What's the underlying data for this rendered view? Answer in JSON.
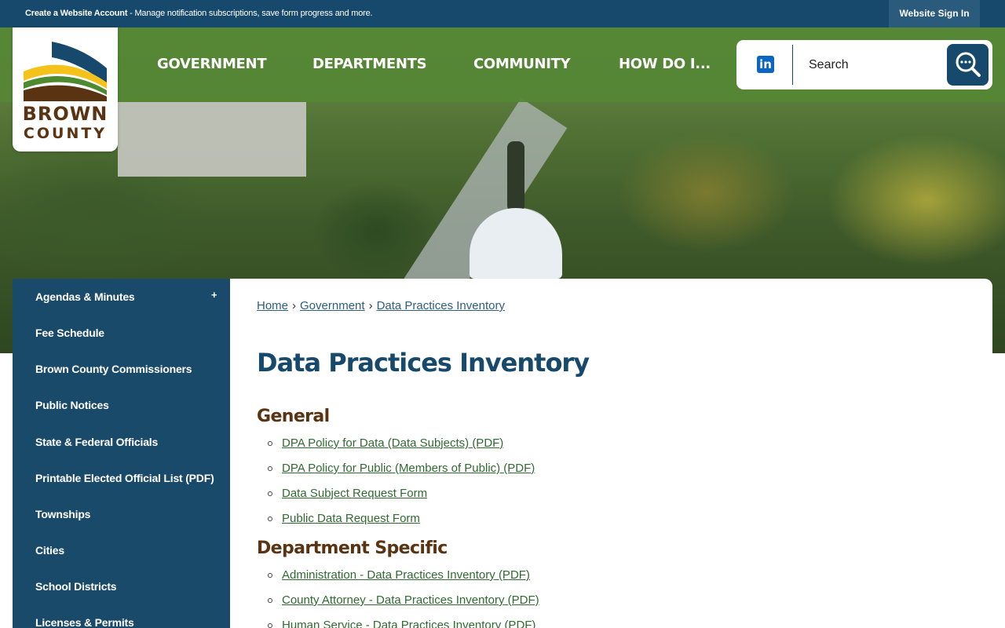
{
  "topbar": {
    "account_link": "Create a Website Account",
    "account_desc": " - Manage notification subscriptions, save form progress and more.",
    "signin": "Website Sign In"
  },
  "logo": {
    "line1": "BROWN",
    "line2": "COUNTY"
  },
  "nav": [
    "GOVERNMENT",
    "DEPARTMENTS",
    "COMMUNITY",
    "HOW DO I..."
  ],
  "search": {
    "placeholder": "Search",
    "social": "in"
  },
  "sidebar": {
    "items": [
      "Agendas & Minutes",
      "Fee Schedule",
      "Brown County Commissioners",
      "Public Notices",
      "State & Federal Officials",
      "Printable Elected Official List (PDF)",
      "Townships",
      "Cities",
      "School Districts",
      "Licenses & Permits"
    ],
    "expand": "+"
  },
  "breadcrumb": [
    "Home",
    "Government",
    "Data Practices Inventory"
  ],
  "page_title": "Data Practices Inventory",
  "sections": [
    {
      "heading": "General",
      "links": [
        "DPA Policy for Data (Data Subjects) (PDF)",
        "DPA Policy for Public (Members of Public) (PDF)",
        "Data Subject Request Form",
        "Public Data Request Form"
      ]
    },
    {
      "heading": "Department Specific",
      "links": [
        "Administration - Data Practices Inventory (PDF)",
        "County Attorney - Data Practices Inventory (PDF)",
        "Human Service - Data Practices Inventory (PDF)"
      ]
    }
  ],
  "colors": {
    "primary_blue": "#16496b",
    "nav_green": "#548734",
    "heading_brown": "#5a3313",
    "link_green": "#2f6b30"
  }
}
